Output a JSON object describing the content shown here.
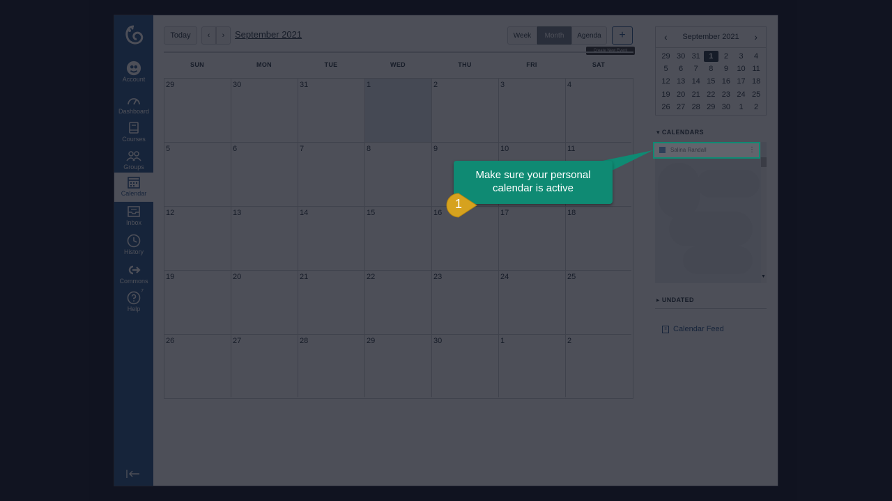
{
  "nav": {
    "items": [
      {
        "key": "account",
        "label": "Account",
        "icon": "account-avatar-icon"
      },
      {
        "key": "dashboard",
        "label": "Dashboard",
        "icon": "dashboard-gauge-icon"
      },
      {
        "key": "courses",
        "label": "Courses",
        "icon": "book-icon"
      },
      {
        "key": "groups",
        "label": "Groups",
        "icon": "people-icon"
      },
      {
        "key": "calendar",
        "label": "Calendar",
        "icon": "calendar-icon",
        "active": true
      },
      {
        "key": "inbox",
        "label": "Inbox",
        "icon": "inbox-icon"
      },
      {
        "key": "history",
        "label": "History",
        "icon": "clock-icon"
      },
      {
        "key": "commons",
        "label": "Commons",
        "icon": "commons-arrow-icon"
      },
      {
        "key": "help",
        "label": "Help",
        "icon": "help-icon",
        "badge": "7"
      }
    ]
  },
  "toolbar": {
    "today_label": "Today",
    "prev_label": "‹",
    "next_label": "›",
    "month_title": "September 2021",
    "views": [
      {
        "label": "Week",
        "active": false
      },
      {
        "label": "Month",
        "active": true
      },
      {
        "label": "Agenda",
        "active": false
      }
    ],
    "create_label": "+",
    "create_tooltip": "Create New Event"
  },
  "calendar": {
    "weekdays": [
      "SUN",
      "MON",
      "TUE",
      "WED",
      "THU",
      "FRI",
      "SAT"
    ],
    "weeks": [
      [
        "29",
        "30",
        "31",
        "1",
        "2",
        "3",
        "4"
      ],
      [
        "5",
        "6",
        "7",
        "8",
        "9",
        "10",
        "11"
      ],
      [
        "12",
        "13",
        "14",
        "15",
        "16",
        "17",
        "18"
      ],
      [
        "19",
        "20",
        "21",
        "22",
        "23",
        "24",
        "25"
      ],
      [
        "26",
        "27",
        "28",
        "29",
        "30",
        "1",
        "2"
      ]
    ],
    "today_week": 0,
    "today_day": 3
  },
  "mini_calendar": {
    "title": "September 2021",
    "prev_label": "‹",
    "next_label": "›",
    "weeks": [
      [
        "29",
        "30",
        "31",
        "1",
        "2",
        "3",
        "4"
      ],
      [
        "5",
        "6",
        "7",
        "8",
        "9",
        "10",
        "11"
      ],
      [
        "12",
        "13",
        "14",
        "15",
        "16",
        "17",
        "18"
      ],
      [
        "19",
        "20",
        "21",
        "22",
        "23",
        "24",
        "25"
      ],
      [
        "26",
        "27",
        "28",
        "29",
        "30",
        "1",
        "2"
      ]
    ],
    "today_week": 0,
    "today_day": 3
  },
  "calendars": {
    "title": "CALENDARS",
    "items": [
      {
        "name": "Salina Randall",
        "color": "#1a5fa8"
      }
    ],
    "kebab": "⋮"
  },
  "undated": {
    "title": "UNDATED"
  },
  "feed": {
    "label": "Calendar Feed"
  },
  "tutorial": {
    "callout_line1": "Make sure your personal",
    "callout_line2": "calendar is active",
    "step_number": "1"
  },
  "colors": {
    "nav_bg": "#2d5a8c",
    "callout": "#0f8a73",
    "step_badge": "#d6a21e"
  }
}
